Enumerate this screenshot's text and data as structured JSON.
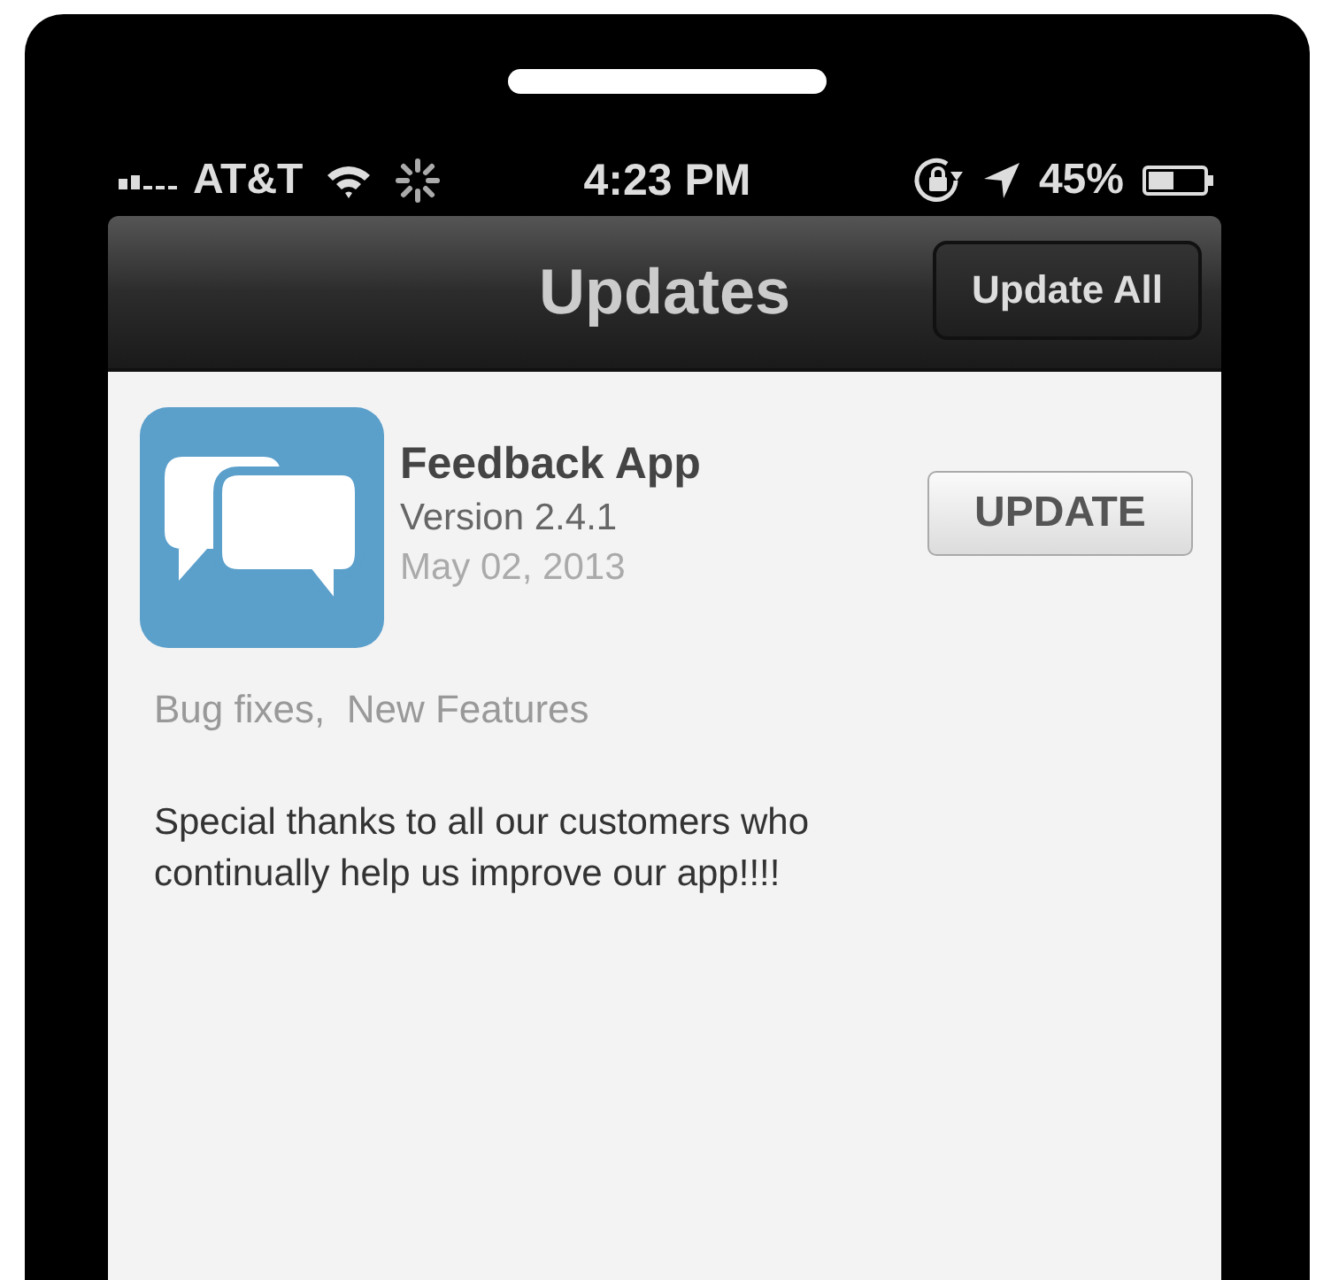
{
  "status_bar": {
    "carrier": "AT&T",
    "time": "4:23 PM",
    "battery": "45%"
  },
  "nav_bar": {
    "title": "Updates",
    "button": "Update All"
  },
  "updates": [
    {
      "name": "Feedback App",
      "version": "Version 2.4.1",
      "date": "May 02, 2013",
      "button": "UPDATE",
      "tags": "Bug fixes,  New Features",
      "notes": "Special thanks to all our customers who continually help us improve our app!!!!"
    }
  ]
}
